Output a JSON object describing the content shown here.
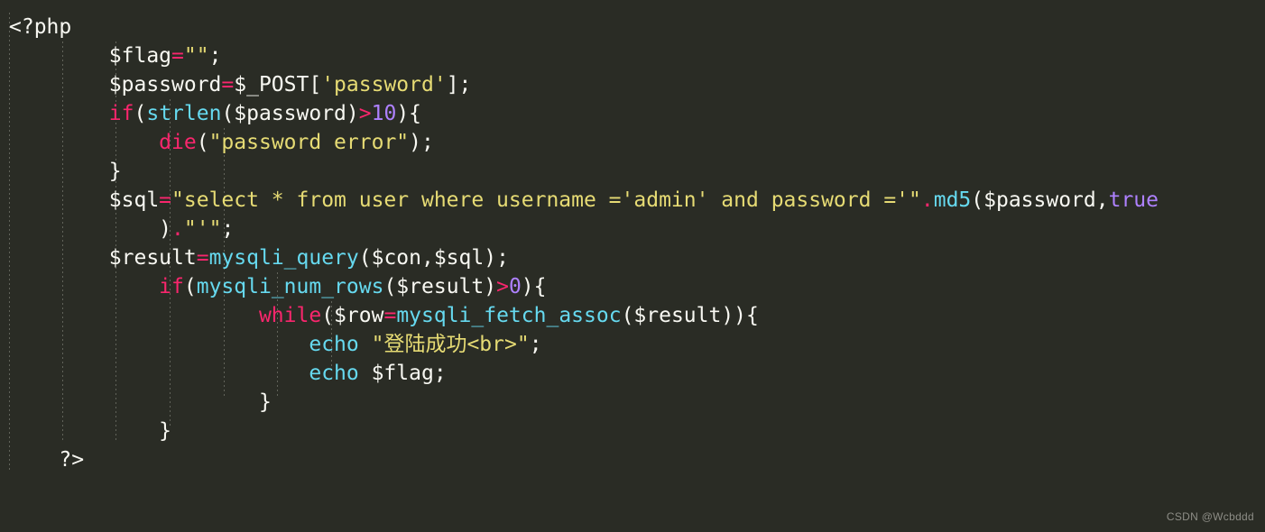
{
  "editor": {
    "language": "php",
    "background_color": "#2a2c25",
    "font_size_px": 23,
    "line_height_px": 32,
    "indent_guide_color": "#c8c8be",
    "palette": {
      "plain": "#f8f8f2",
      "keyword": "#f9266d",
      "function": "#66d9ef",
      "string": "#e6db74",
      "number": "#ae81ff",
      "operator": "#f9266d"
    },
    "indent_guides_x": [
      10,
      69,
      128,
      188,
      248,
      307,
      367
    ],
    "lines": [
      {
        "indent": "",
        "tokens": [
          {
            "t": "tag",
            "v": "<?php"
          }
        ]
      },
      {
        "indent": "        ",
        "tokens": [
          {
            "t": "plain",
            "v": "$flag"
          },
          {
            "t": "op",
            "v": "="
          },
          {
            "t": "str",
            "v": "\"\""
          },
          {
            "t": "plain",
            "v": ";"
          }
        ]
      },
      {
        "indent": "        ",
        "tokens": [
          {
            "t": "plain",
            "v": "$password"
          },
          {
            "t": "op",
            "v": "="
          },
          {
            "t": "plain",
            "v": "$_POST["
          },
          {
            "t": "str",
            "v": "'password'"
          },
          {
            "t": "plain",
            "v": "];"
          }
        ]
      },
      {
        "indent": "        ",
        "tokens": [
          {
            "t": "kw",
            "v": "if"
          },
          {
            "t": "plain",
            "v": "("
          },
          {
            "t": "fn",
            "v": "strlen"
          },
          {
            "t": "plain",
            "v": "($password)"
          },
          {
            "t": "op",
            "v": ">"
          },
          {
            "t": "num",
            "v": "10"
          },
          {
            "t": "plain",
            "v": "){"
          }
        ]
      },
      {
        "indent": "            ",
        "tokens": [
          {
            "t": "kw",
            "v": "die"
          },
          {
            "t": "plain",
            "v": "("
          },
          {
            "t": "str",
            "v": "\"password error\""
          },
          {
            "t": "plain",
            "v": ");"
          }
        ]
      },
      {
        "indent": "        ",
        "tokens": [
          {
            "t": "plain",
            "v": "}"
          }
        ]
      },
      {
        "indent": "        ",
        "tokens": [
          {
            "t": "plain",
            "v": "$sql"
          },
          {
            "t": "op",
            "v": "="
          },
          {
            "t": "str",
            "v": "\"select * from user where username ='admin' and password ='\""
          },
          {
            "t": "op",
            "v": "."
          },
          {
            "t": "fn",
            "v": "md5"
          },
          {
            "t": "plain",
            "v": "($password,"
          },
          {
            "t": "num",
            "v": "true"
          }
        ]
      },
      {
        "indent": "            ",
        "tokens": [
          {
            "t": "plain",
            "v": ")"
          },
          {
            "t": "op",
            "v": "."
          },
          {
            "t": "str",
            "v": "\"'\""
          },
          {
            "t": "plain",
            "v": ";"
          }
        ]
      },
      {
        "indent": "        ",
        "tokens": [
          {
            "t": "plain",
            "v": "$result"
          },
          {
            "t": "op",
            "v": "="
          },
          {
            "t": "fn",
            "v": "mysqli_query"
          },
          {
            "t": "plain",
            "v": "($con,$sql);"
          }
        ]
      },
      {
        "indent": "            ",
        "tokens": [
          {
            "t": "kw",
            "v": "if"
          },
          {
            "t": "plain",
            "v": "("
          },
          {
            "t": "fn",
            "v": "mysqli_num_rows"
          },
          {
            "t": "plain",
            "v": "($result)"
          },
          {
            "t": "op",
            "v": ">"
          },
          {
            "t": "num",
            "v": "0"
          },
          {
            "t": "plain",
            "v": "){"
          }
        ]
      },
      {
        "indent": "                    ",
        "tokens": [
          {
            "t": "kw",
            "v": "while"
          },
          {
            "t": "plain",
            "v": "($row"
          },
          {
            "t": "op",
            "v": "="
          },
          {
            "t": "fn",
            "v": "mysqli_fetch_assoc"
          },
          {
            "t": "plain",
            "v": "($result)){"
          }
        ]
      },
      {
        "indent": "                        ",
        "tokens": [
          {
            "t": "fn",
            "v": "echo"
          },
          {
            "t": "plain",
            "v": " "
          },
          {
            "t": "str",
            "v": "\"登陆成功<br>\""
          },
          {
            "t": "plain",
            "v": ";"
          }
        ]
      },
      {
        "indent": "                        ",
        "tokens": [
          {
            "t": "fn",
            "v": "echo"
          },
          {
            "t": "plain",
            "v": " $flag;"
          }
        ]
      },
      {
        "indent": "                    ",
        "tokens": [
          {
            "t": "plain",
            "v": "}"
          }
        ]
      },
      {
        "indent": "            ",
        "tokens": [
          {
            "t": "plain",
            "v": "}"
          }
        ]
      },
      {
        "indent": "    ",
        "tokens": [
          {
            "t": "tag",
            "v": "?>"
          }
        ]
      }
    ]
  },
  "watermark": {
    "text": "CSDN @Wcbddd"
  }
}
